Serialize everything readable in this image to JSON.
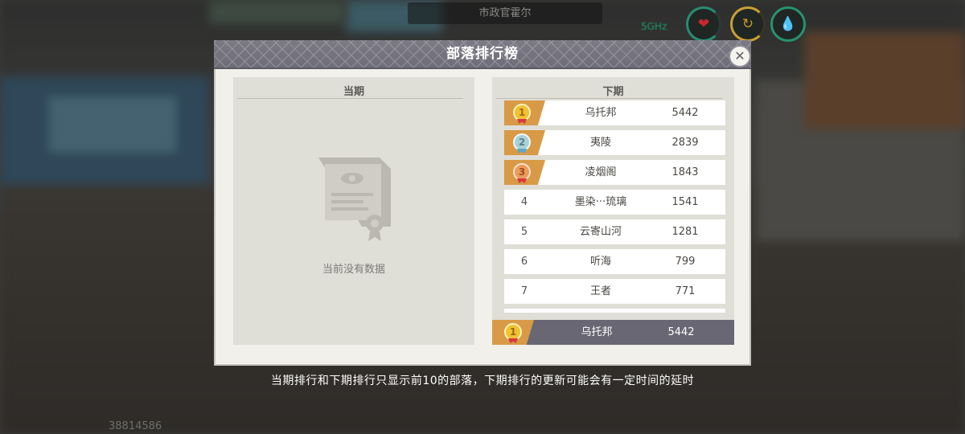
{
  "hud": {
    "title": "市政官霍尔",
    "signal_label": "5GHz",
    "stats": [
      {
        "name": "health",
        "icon": "heart-icon",
        "symbol": "❤"
      },
      {
        "name": "energy",
        "icon": "energy-icon",
        "symbol": "↻"
      },
      {
        "name": "water",
        "icon": "water-drop-icon",
        "symbol": "💧"
      }
    ]
  },
  "panel": {
    "title": "部落排行榜",
    "close_symbol": "✕",
    "current": {
      "header": "当期",
      "empty_text": "当前没有数据"
    },
    "next": {
      "header": "下期",
      "rows": [
        {
          "rank": "1",
          "name": "乌托邦",
          "score": "5442",
          "medal": "gold"
        },
        {
          "rank": "2",
          "name": "夷陵",
          "score": "2839",
          "medal": "silver"
        },
        {
          "rank": "3",
          "name": "凌烟阁",
          "score": "1843",
          "medal": "bronze"
        },
        {
          "rank": "4",
          "name": "墨染···琉璃",
          "score": "1541"
        },
        {
          "rank": "5",
          "name": "云寄山河",
          "score": "1281"
        },
        {
          "rank": "6",
          "name": "听海",
          "score": "799"
        },
        {
          "rank": "7",
          "name": "王者",
          "score": "771"
        }
      ],
      "my_tribe": {
        "rank": "1",
        "name": "乌托邦",
        "score": "5442",
        "medal": "gold"
      }
    }
  },
  "footnote": "当期排行和下期排行只显示前10的部落，下期排行的更新可能会有一定时间的延时",
  "player_id": "38814586",
  "colors": {
    "accent": "#d89a47",
    "header": "#74737e",
    "panel_bg": "#f1f0ea"
  }
}
